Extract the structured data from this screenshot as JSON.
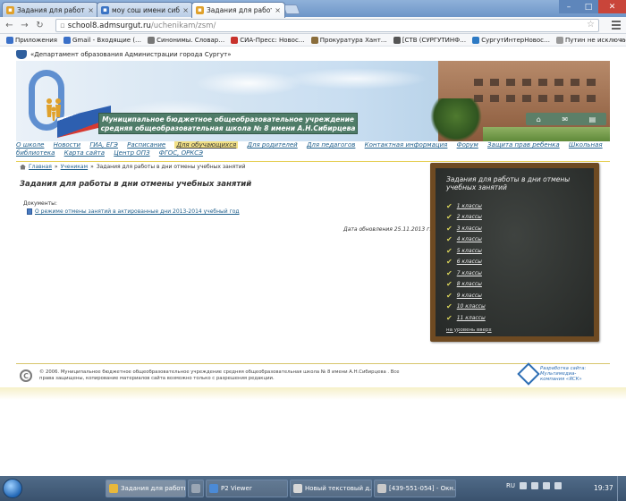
{
  "browser": {
    "tabs": [
      {
        "title": "Задания для работы в д",
        "active": false
      },
      {
        "title": "моу сош имени сибирцев",
        "active": false
      },
      {
        "title": "Задания для работы в д",
        "active": true
      }
    ],
    "url_host": "school8.admsurgut.ru",
    "url_path": "/uchenikam/zsm/",
    "bookmarks": [
      {
        "label": "Приложения",
        "color": "#3a70c8"
      },
      {
        "label": "Gmail - Входящие (…",
        "color": "#3a70c8"
      },
      {
        "label": "Синонимы. Словар…",
        "color": "#777777"
      },
      {
        "label": "СИА-Пресс: Новос…",
        "color": "#c8322c"
      },
      {
        "label": "Прокуратура Хант…",
        "color": "#8a6d3b"
      },
      {
        "label": "[СТВ (СУРГУТИНФ…",
        "color": "#555555"
      },
      {
        "label": "СургутИнтерНовос…",
        "color": "#2d7ac4"
      },
      {
        "label": "Путин не исключае…",
        "color": "#999999"
      }
    ],
    "bookmarks_more": "»"
  },
  "site": {
    "department": "«Департамент образования Администрации города Сургут»",
    "school_title_line1": "Муниципальное бюджетное общеобразовательное учреждение",
    "school_title_line2": "средняя общеобразовательная школа № 8 имени А.Н.Сибирцева",
    "nav": [
      {
        "label": "О школе",
        "current": false
      },
      {
        "label": "Новости",
        "current": false
      },
      {
        "label": "ГИА, ЕГЭ",
        "current": false
      },
      {
        "label": "Расписание",
        "current": false
      },
      {
        "label": "Для обучающихся",
        "current": true
      },
      {
        "label": "Для родителей",
        "current": false
      },
      {
        "label": "Для педагогов",
        "current": false
      },
      {
        "label": "Контактная информация",
        "current": false
      },
      {
        "label": "Форум",
        "current": false
      },
      {
        "label": "Защита прав ребенка",
        "current": false
      },
      {
        "label": "Школьная",
        "current": false
      },
      {
        "label": "библиотека",
        "current": false
      },
      {
        "label": "Карта сайта",
        "current": false
      },
      {
        "label": "Центр ОПЗ",
        "current": false
      },
      {
        "label": "ФГОС, ОРКСЭ",
        "current": false
      }
    ],
    "breadcrumb": [
      {
        "label": "Главная",
        "link": true
      },
      {
        "label": "Ученикам",
        "link": true
      },
      {
        "label": "Задания для работы в дни отмены учебных занятий",
        "link": false
      }
    ],
    "page_title": "Задания для работы в дни отмены учебных занятий",
    "docs_label": "Документы:",
    "doc_link": "О режиме отмены занятий в актированные дни 2013-2014 учебный год",
    "updated": "Дата обновления 25.11.2013 г.",
    "board": {
      "title": "Задания для работы в дни отмены учебных занятий",
      "items": [
        "1 классы",
        "2 классы",
        "3 классы",
        "4 классы",
        "5 классы",
        "6 классы",
        "7 классы",
        "8 классы",
        "9 классы",
        "10 классы",
        "11 классы"
      ],
      "up_link": "на уровень вверх"
    },
    "footer_text": "© 2006. Муниципальное бюджетное общеобразовательное учреждение средняя общеобразовательная школа № 8 имени А.Н.Сибирцева . Все права защищены, копирование материалов сайта возможно только с разрешения редакции.",
    "developer_line1": "Разработка сайта:",
    "developer_line2": "Мультимедиа-",
    "developer_line3": "компания «ЯСК»"
  },
  "taskbar": {
    "tasks": [
      {
        "label": "Задания для работы…",
        "color": "#e9b83a",
        "active": true
      },
      {
        "label": "",
        "color": "#9aa6b4",
        "active": false
      },
      {
        "label": "P2 Viewer",
        "color": "#4b8ad6",
        "active": false
      },
      {
        "label": "Новый текстовый д…",
        "color": "#d8d8d8",
        "active": false
      },
      {
        "label": "[439-551-054] - Окн…",
        "color": "#c9c9c9",
        "active": false
      }
    ],
    "lang": "RU",
    "clock": "19:37"
  }
}
